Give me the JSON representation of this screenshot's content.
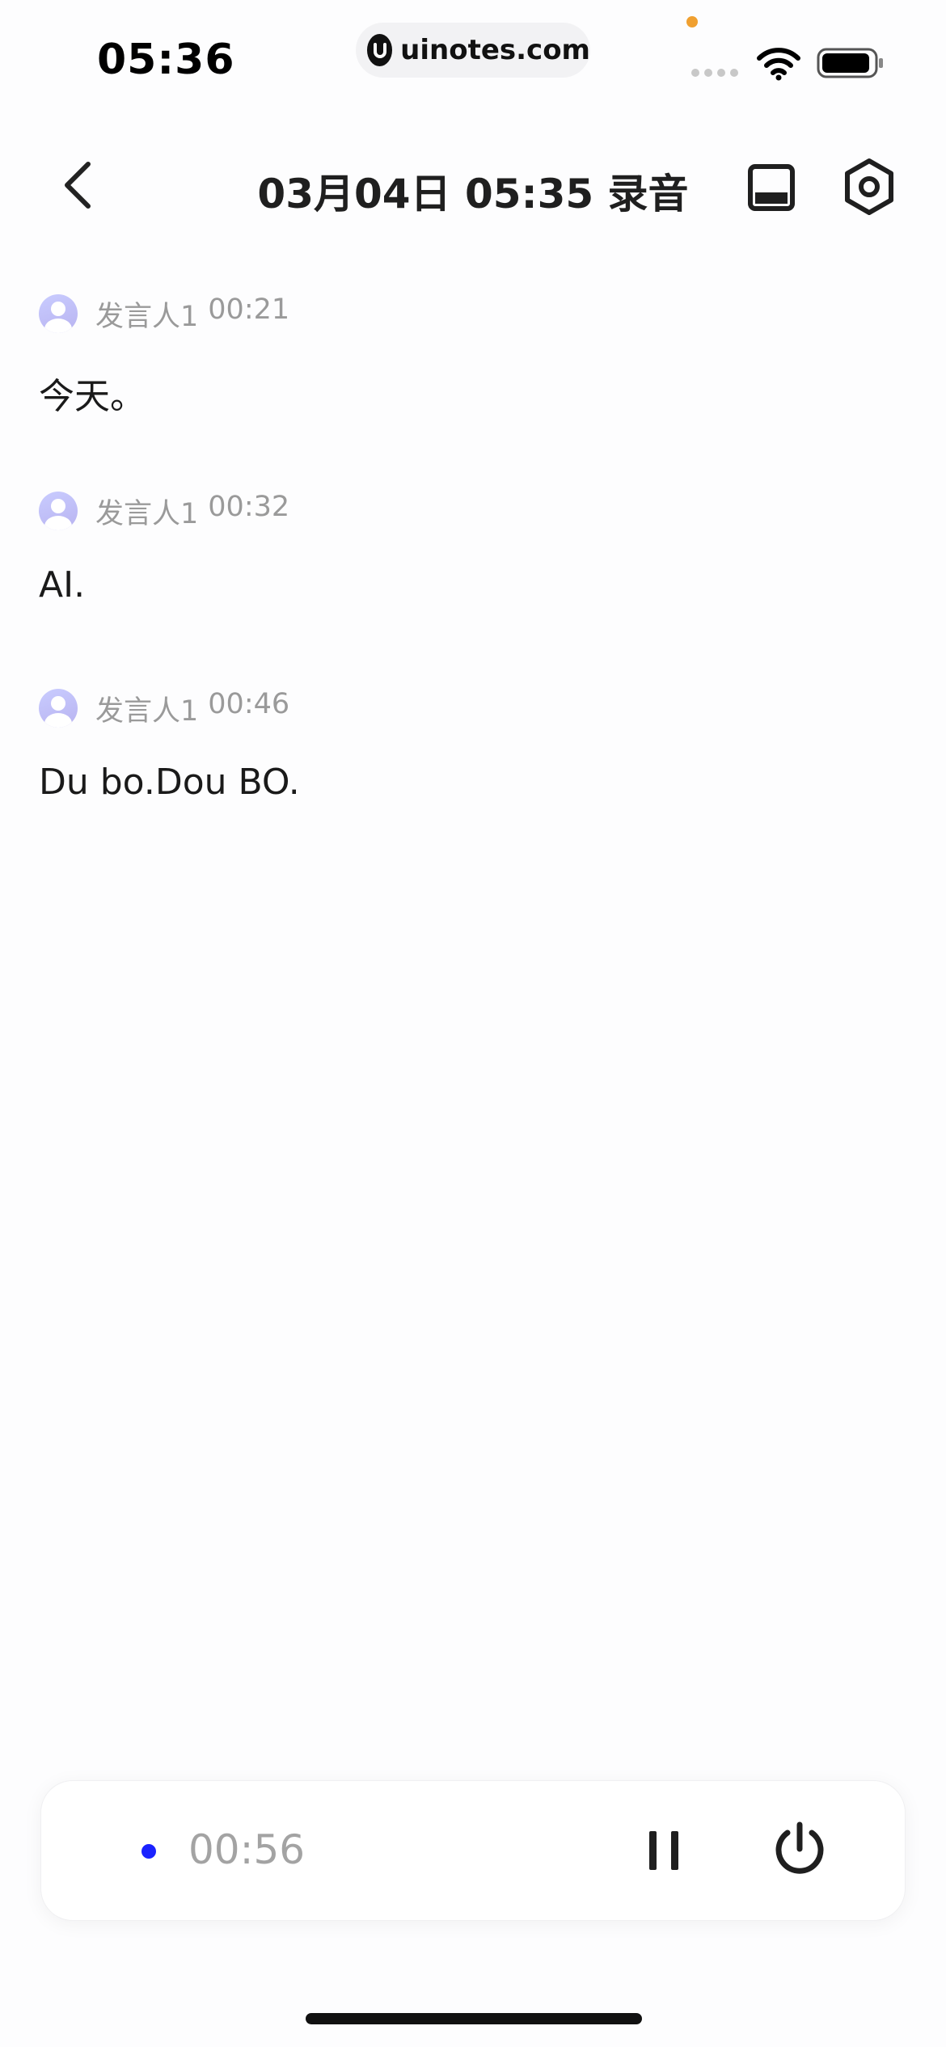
{
  "status_bar": {
    "time": "05:36",
    "url": "uinotes.com",
    "icons": [
      "wifi-icon",
      "battery-icon",
      "cellular-signal-icon"
    ]
  },
  "nav": {
    "title": "03月04日 05:35 录音",
    "icons": [
      "back-chevron-icon",
      "layout-panel-icon",
      "settings-gear-icon"
    ]
  },
  "transcript": [
    {
      "speaker": "发言人1",
      "time": "00:21",
      "text": "今天。"
    },
    {
      "speaker": "发言人1",
      "time": "00:32",
      "text": "AI."
    },
    {
      "speaker": "发言人1",
      "time": "00:46",
      "text": "Du bo.Dou BO."
    }
  ],
  "controls": {
    "elapsed": "00:56",
    "recording_dot_color": "#1a22ff",
    "icons": [
      "pause-icon",
      "power-icon"
    ]
  }
}
